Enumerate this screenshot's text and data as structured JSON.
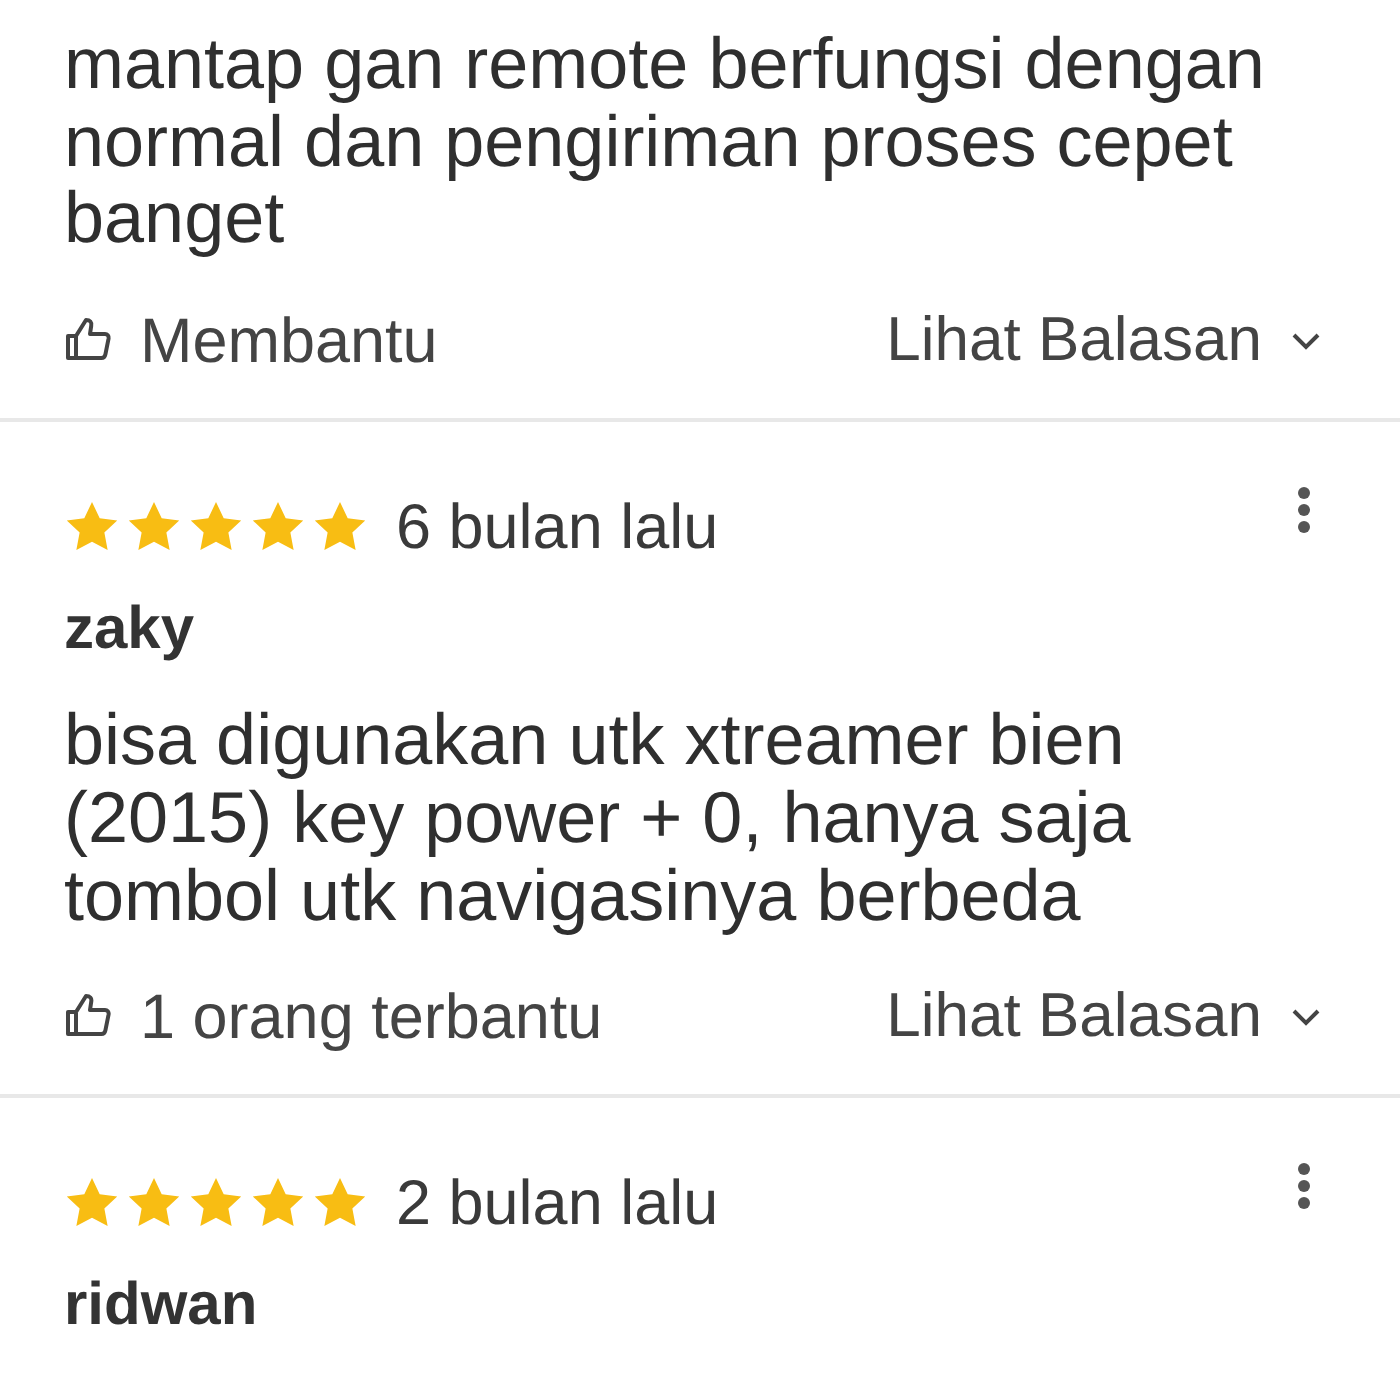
{
  "reviews": [
    {
      "body": "mantap gan remote berfungsi dengan normal dan pengiriman proses cepet banget",
      "helpful": "Membantu",
      "replies": "Lihat Balasan"
    },
    {
      "stars": 5,
      "date": "6 bulan lalu",
      "author": "zaky",
      "body": "bisa digunakan utk xtreamer bien (2015) key power + 0, hanya saja tombol utk navigasinya berbeda",
      "helpful": "1 orang terbantu",
      "replies": "Lihat Balasan"
    },
    {
      "stars": 5,
      "date": "2 bulan lalu",
      "author": "ridwan"
    }
  ]
}
